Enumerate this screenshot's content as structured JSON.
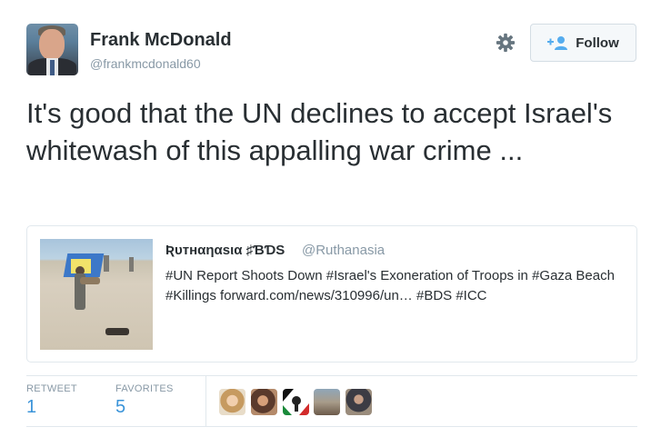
{
  "author": {
    "name": "Frank McDonald",
    "handle": "@frankmcdonald60",
    "avatar_icon": "profile-photo"
  },
  "actions": {
    "settings_icon": "gear-icon",
    "follow_icon": "add-user-icon",
    "follow_label": "Follow"
  },
  "tweet": {
    "text": "It's good that the UN declines to accept Israel's whitewash of this appalling war crime ..."
  },
  "quoted": {
    "name": "Ʀυтнαηαѕια ♯ƁƊS",
    "handle": "@Ruthanasia",
    "text": "#UN Report Shoots Down #Israel's Exoneration of Troops in #Gaza Beach #Killings forward.com/news/310996/un… #BDS #ICC"
  },
  "stats": {
    "retweet_label": "RETWEET",
    "retweet_count": "1",
    "favorites_label": "FAVORITES",
    "favorites_count": "5"
  },
  "colors": {
    "link_blue": "#3b94d9",
    "muted": "#8899a6",
    "border": "#e1e8ed"
  }
}
